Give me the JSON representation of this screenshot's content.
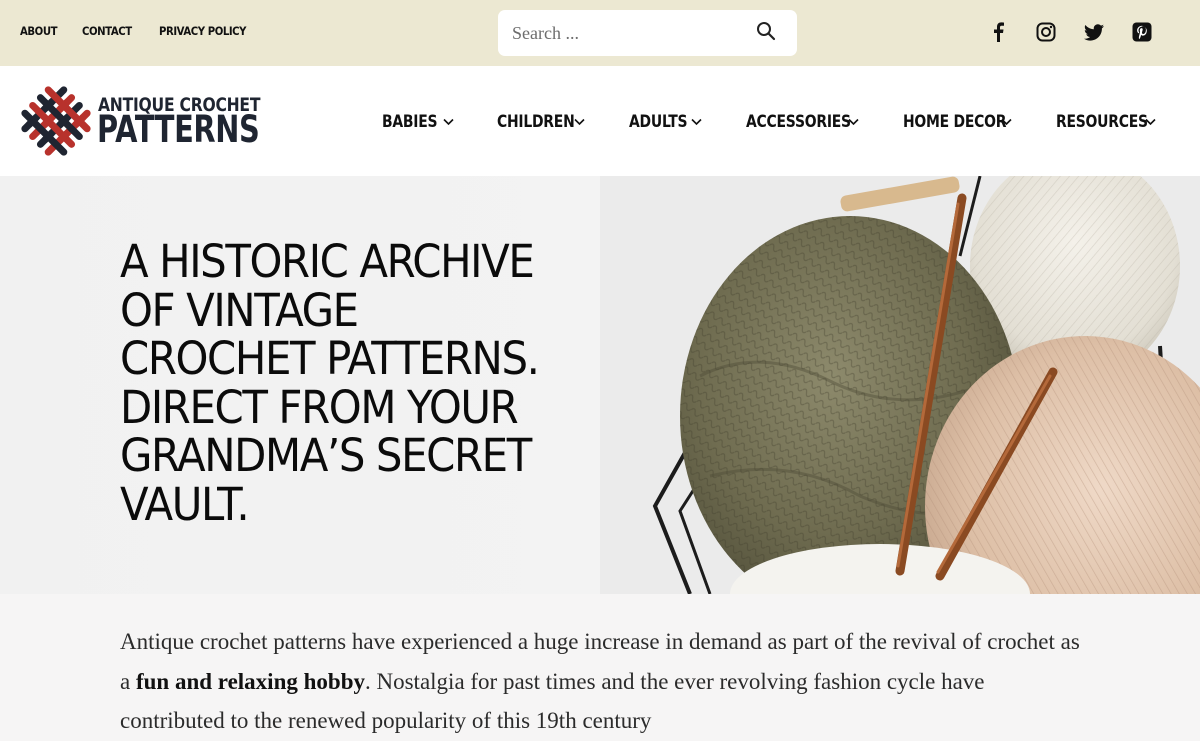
{
  "top_links": [
    "ABOUT",
    "CONTACT",
    "PRIVACY POLICY"
  ],
  "search": {
    "placeholder": "Search ..."
  },
  "social_icons": [
    "facebook-icon",
    "instagram-icon",
    "twitter-icon",
    "pinterest-icon"
  ],
  "logo": {
    "line1": "ANTIQUE CROCHET",
    "line2": "PATTERNS",
    "colors": {
      "dark": "#1f2531",
      "red": "#b8322c"
    }
  },
  "nav": [
    {
      "label": "BABIES"
    },
    {
      "label": "CHILDREN"
    },
    {
      "label": "ADULTS"
    },
    {
      "label": "ACCESSORIES"
    },
    {
      "label": "HOME DECOR"
    },
    {
      "label": "RESOURCES"
    }
  ],
  "hero": {
    "lines": [
      "A HISTORIC ARCHIVE",
      "OF VINTAGE",
      "CROCHET PATTERNS.",
      "DIRECT FROM YOUR",
      "GRANDMA’S SECRET",
      "VAULT."
    ]
  },
  "intro": {
    "part1": "Antique crochet patterns have experienced a huge increase in demand as part of the revival of crochet as a ",
    "bold": "fun and relaxing hobby",
    "part2": ".  Nostalgia for past times and the ever revolving fashion cycle have contributed to the renewed popularity of this 19th century"
  },
  "colors": {
    "topbar_bg": "#ece8d2",
    "header_bg": "#ffffff",
    "page_bg": "#f6f5f5",
    "text": "#111111"
  }
}
